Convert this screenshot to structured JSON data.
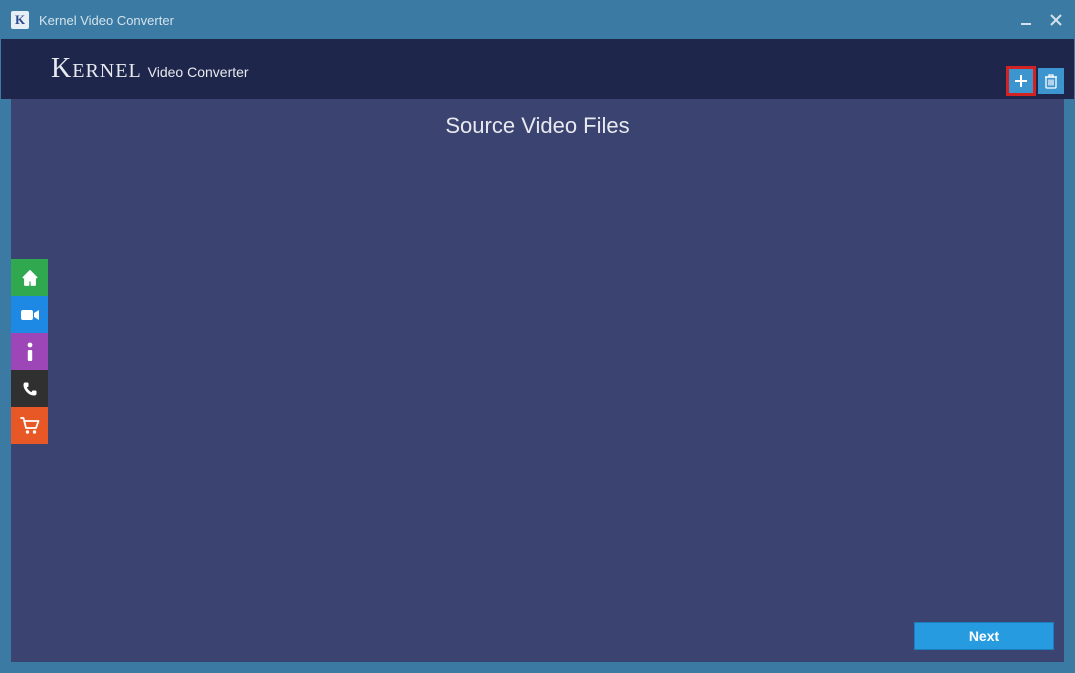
{
  "titlebar": {
    "app_icon_letter": "K",
    "title": "Kernel Video Converter"
  },
  "header": {
    "brand_primary": "Kernel",
    "brand_secondary": "Video Converter"
  },
  "content": {
    "heading": "Source Video Files"
  },
  "footer": {
    "next_label": "Next"
  }
}
